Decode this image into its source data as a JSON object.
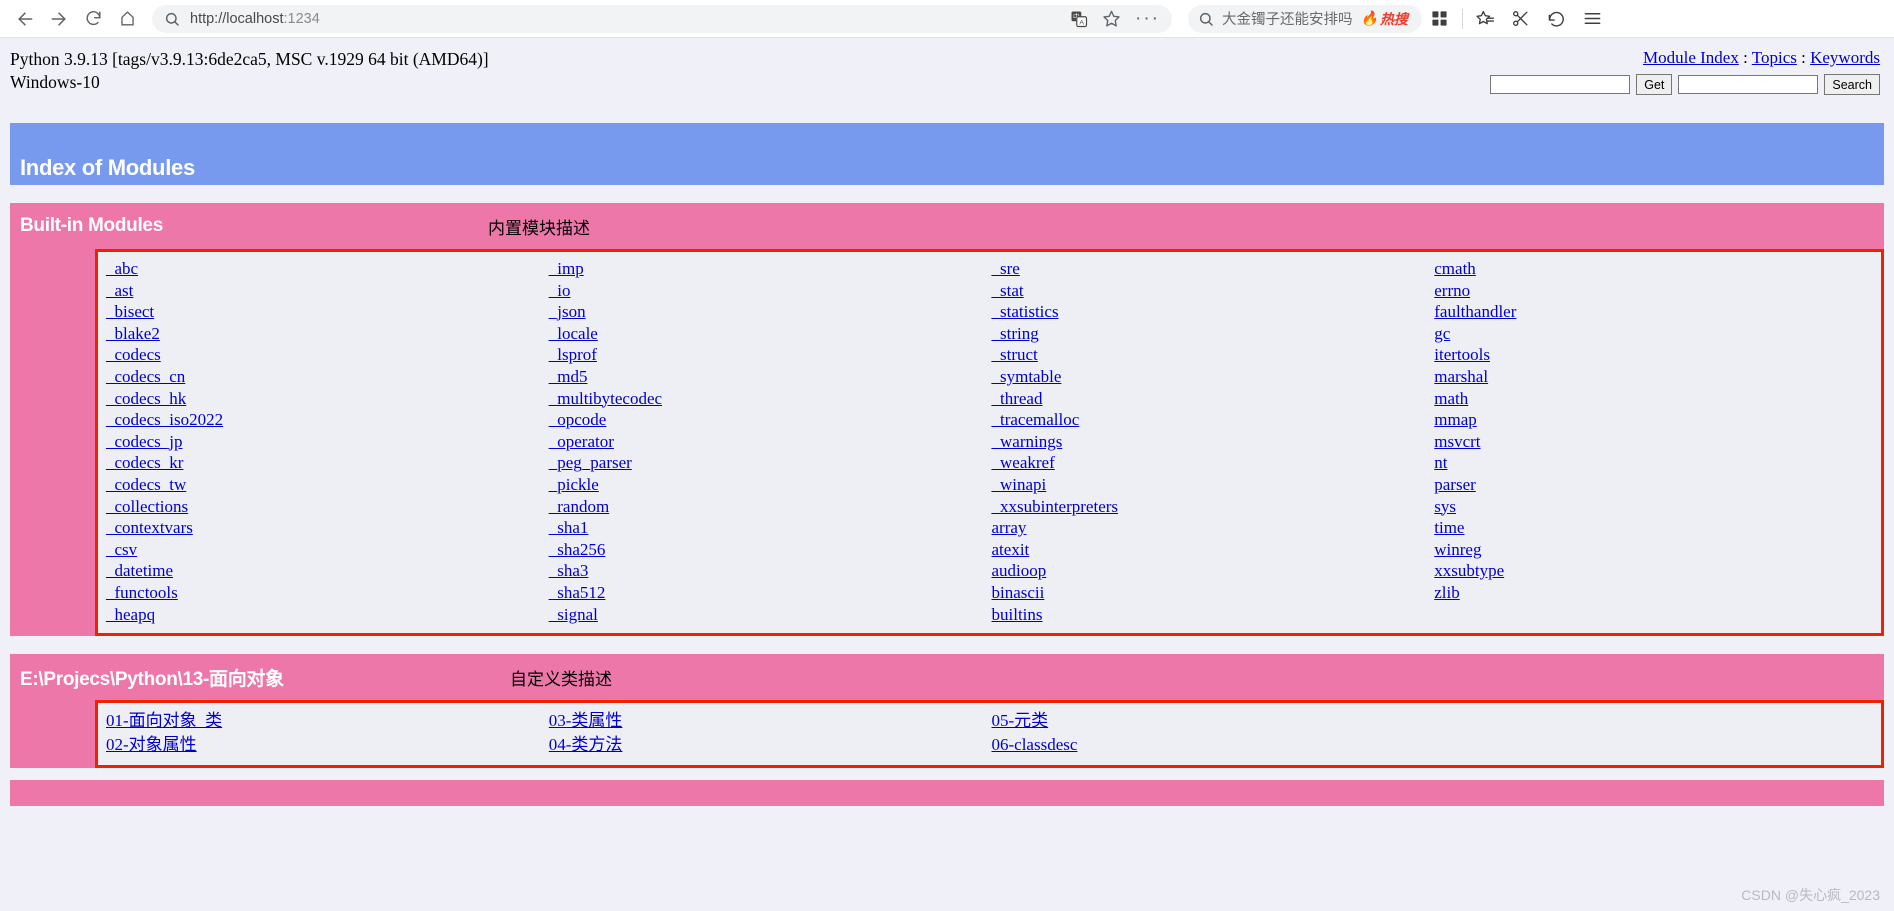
{
  "browser": {
    "back_label": "Back",
    "forward_label": "Forward",
    "reload_label": "Reload",
    "home_label": "Home",
    "url_scheme": "http://localhost",
    "url_port": ":1234",
    "url_full": "http://localhost:1234",
    "translate_label": "Translate",
    "bookmark_label": "Add to favorites",
    "more_label": "More",
    "omnibox_query": "大金镯子还能安排吗",
    "omnibox_hot_label": "热搜",
    "collections_label": "Collections",
    "favorites_label": "Favorites",
    "clip_label": "Clip",
    "history_label": "History",
    "menu_label": "Settings and more"
  },
  "pydoc": {
    "version_line1": "Python 3.9.13 [tags/v3.9.13:6de2ca5, MSC v.1929 64 bit (AMD64)]",
    "version_line2": "Windows-10",
    "nav": {
      "module_index": "Module Index",
      "sep1": " : ",
      "topics": "Topics",
      "sep2": " : ",
      "keywords": "Keywords"
    },
    "get_form": {
      "input_value": "",
      "input_placeholder": "",
      "button_label": "Get"
    },
    "search_form": {
      "input_value": "",
      "input_placeholder": "",
      "button_label": "Search"
    },
    "banner_title": "Index of Modules",
    "builtin_section": {
      "title": "Built-in Modules",
      "description": "内置模块描述",
      "columns": [
        [
          "_abc",
          "_ast",
          "_bisect",
          "_blake2",
          "_codecs",
          "_codecs_cn",
          "_codecs_hk",
          "_codecs_iso2022",
          "_codecs_jp",
          "_codecs_kr",
          "_codecs_tw",
          "_collections",
          "_contextvars",
          "_csv",
          "_datetime",
          "_functools",
          "_heapq"
        ],
        [
          "_imp",
          "_io",
          "_json",
          "_locale",
          "_lsprof",
          "_md5",
          "_multibytecodec",
          "_opcode",
          "_operator",
          "_peg_parser",
          "_pickle",
          "_random",
          "_sha1",
          "_sha256",
          "_sha3",
          "_sha512",
          "_signal"
        ],
        [
          "_sre",
          "_stat",
          "_statistics",
          "_string",
          "_struct",
          "_symtable",
          "_thread",
          "_tracemalloc",
          "_warnings",
          "_weakref",
          "_winapi",
          "_xxsubinterpreters",
          "array",
          "atexit",
          "audioop",
          "binascii",
          "builtins"
        ],
        [
          "cmath",
          "errno",
          "faulthandler",
          "gc",
          "itertools",
          "marshal",
          "math",
          "mmap",
          "msvcrt",
          "nt",
          "parser",
          "sys",
          "time",
          "winreg",
          "xxsubtype",
          "zlib"
        ]
      ]
    },
    "custom_section": {
      "title": "E:\\Projecs\\Python\\13-面向对象",
      "description": "自定义类描述",
      "columns": [
        [
          "01-面向对象_类",
          "02-对象属性"
        ],
        [
          "03-类属性",
          "04-类方法"
        ],
        [
          "05-元类",
          "06-classdesc"
        ],
        []
      ]
    },
    "watermark": "CSDN @失心疯_2023"
  }
}
